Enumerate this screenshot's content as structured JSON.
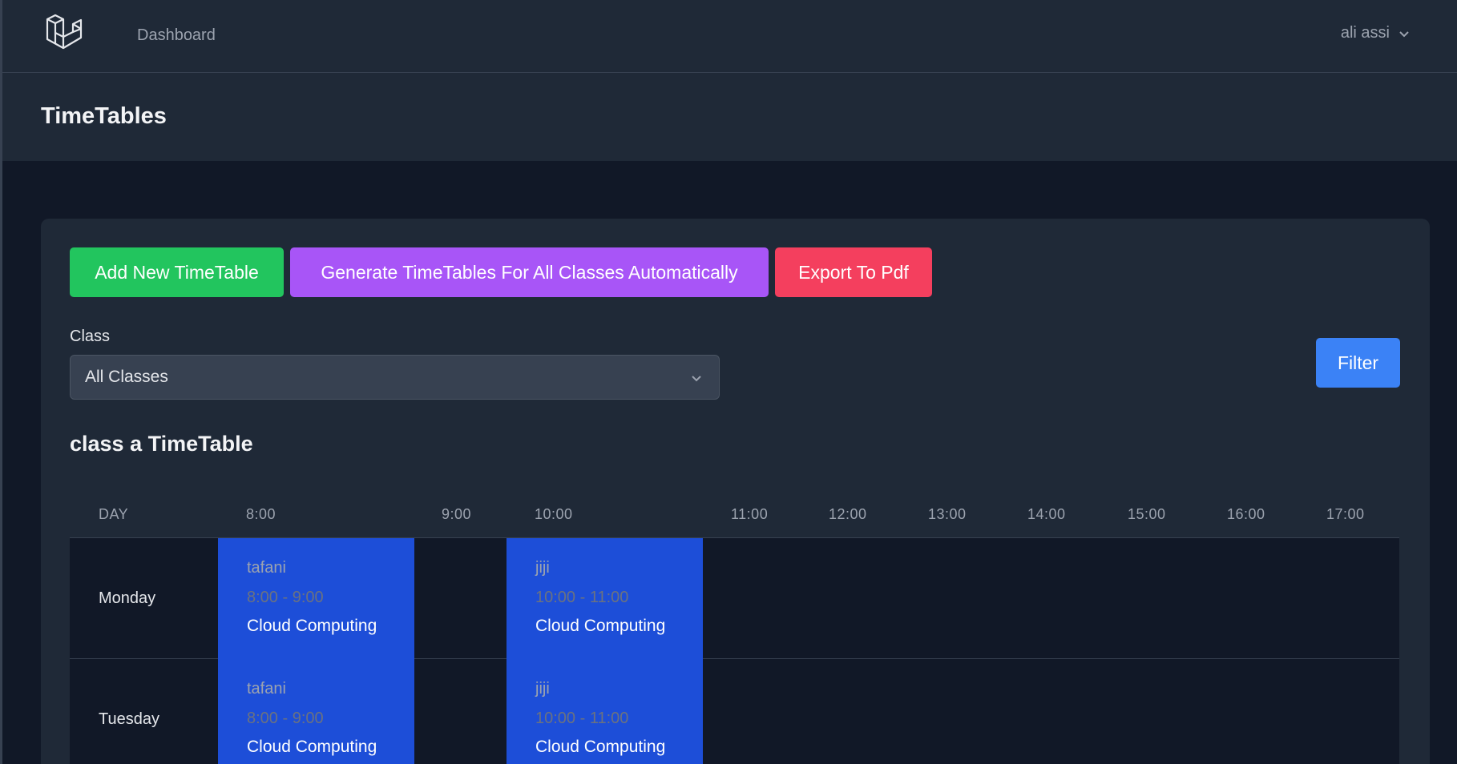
{
  "nav": {
    "dashboard_label": "Dashboard",
    "user_name": "ali assi"
  },
  "header": {
    "title": "TimeTables"
  },
  "actions": {
    "add_label": "Add New TimeTable",
    "generate_label": "Generate TimeTables For All Classes Automatically",
    "export_label": "Export To Pdf"
  },
  "filter": {
    "class_label": "Class",
    "class_selected": "All Classes",
    "filter_label": "Filter"
  },
  "timetable": {
    "title": "class a TimeTable",
    "columns": [
      "DAY",
      "8:00",
      "9:00",
      "10:00",
      "11:00",
      "12:00",
      "13:00",
      "14:00",
      "15:00",
      "16:00",
      "17:00"
    ],
    "rows": [
      {
        "day": "Monday",
        "slots": [
          {
            "teacher": "tafani",
            "time": "8:00 - 9:00",
            "subject": "Cloud Computing"
          },
          {
            "teacher": "jiji",
            "time": "10:00 - 11:00",
            "subject": "Cloud Computing"
          }
        ]
      },
      {
        "day": "Tuesday",
        "slots": [
          {
            "teacher": "tafani",
            "time": "8:00 - 9:00",
            "subject": "Cloud Computing"
          },
          {
            "teacher": "jiji",
            "time": "10:00 - 11:00",
            "subject": "Cloud Computing"
          }
        ]
      }
    ]
  },
  "colors": {
    "page_bg": "#111827",
    "panel_bg": "#1f2937",
    "green": "#22c55e",
    "purple": "#a855f7",
    "red": "#f43f5e",
    "blue": "#3b82f6",
    "slot_blue": "#1d4ed8"
  }
}
